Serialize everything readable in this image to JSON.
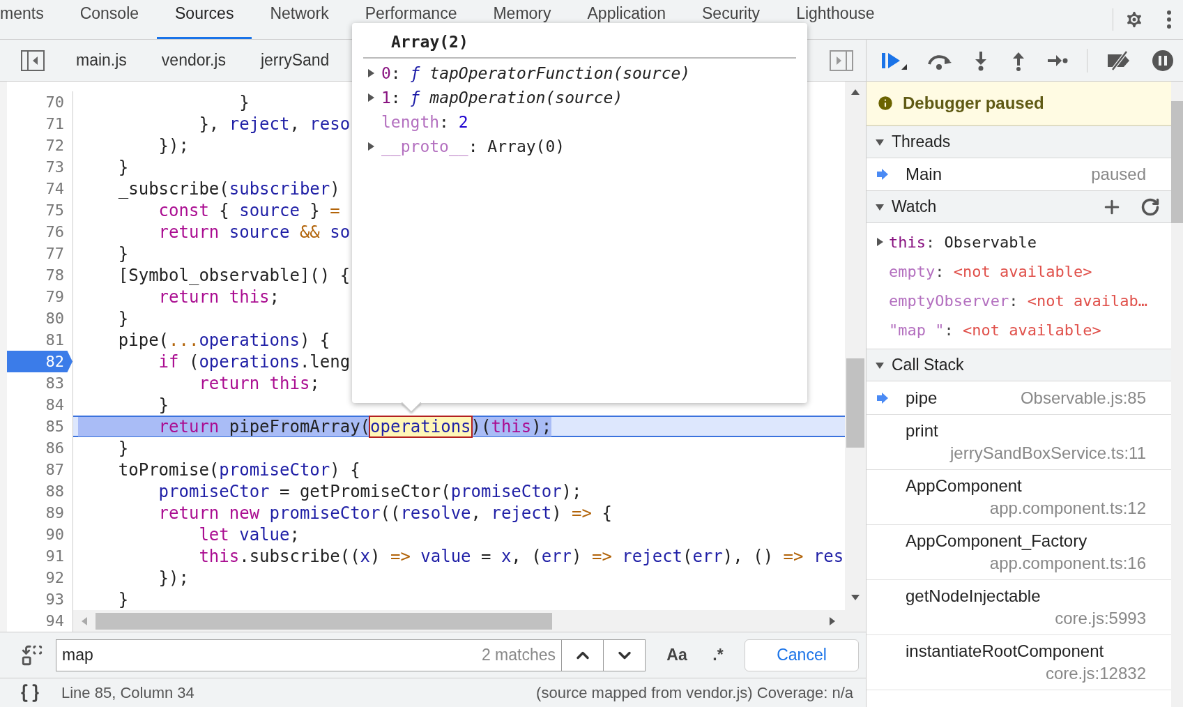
{
  "tabs": [
    {
      "label": "ments",
      "selected": false
    },
    {
      "label": "Console",
      "selected": false
    },
    {
      "label": "Sources",
      "selected": true
    },
    {
      "label": "Network",
      "selected": false
    },
    {
      "label": "Performance",
      "selected": false
    },
    {
      "label": "Memory",
      "selected": false
    },
    {
      "label": "Application",
      "selected": false
    },
    {
      "label": "Security",
      "selected": false
    },
    {
      "label": "Lighthouse",
      "selected": false
    }
  ],
  "file_tabs": [
    "main.js",
    "vendor.js",
    "jerrySand"
  ],
  "code": {
    "lines": [
      {
        "number": "70",
        "breakpoint": false,
        "current": false,
        "tokens": [
          {
            "text": "                }",
            "kind": "plain"
          }
        ]
      },
      {
        "number": "71",
        "breakpoint": false,
        "current": false,
        "tokens": [
          {
            "text": "            }, ",
            "kind": "plain"
          },
          {
            "text": "reject",
            "kind": "name"
          },
          {
            "text": ", ",
            "kind": "plain"
          },
          {
            "text": "reso",
            "kind": "name"
          }
        ]
      },
      {
        "number": "72",
        "breakpoint": false,
        "current": false,
        "tokens": [
          {
            "text": "        });",
            "kind": "plain"
          }
        ]
      },
      {
        "number": "73",
        "breakpoint": false,
        "current": false,
        "tokens": [
          {
            "text": "    }",
            "kind": "plain"
          }
        ]
      },
      {
        "number": "74",
        "breakpoint": false,
        "current": false,
        "tokens": [
          {
            "text": "    _subscribe(",
            "kind": "plain"
          },
          {
            "text": "subscriber",
            "kind": "name"
          },
          {
            "text": ")",
            "kind": "plain"
          }
        ]
      },
      {
        "number": "75",
        "breakpoint": false,
        "current": false,
        "tokens": [
          {
            "text": "        const",
            "kind": "keyword"
          },
          {
            "text": " { ",
            "kind": "plain"
          },
          {
            "text": "source",
            "kind": "name"
          },
          {
            "text": " } ",
            "kind": "plain"
          },
          {
            "text": "=",
            "kind": "operator"
          }
        ]
      },
      {
        "number": "76",
        "breakpoint": false,
        "current": false,
        "tokens": [
          {
            "text": "        return",
            "kind": "keyword"
          },
          {
            "text": " source",
            "kind": "name"
          },
          {
            "text": " &&",
            "kind": "operator"
          },
          {
            "text": " so",
            "kind": "name"
          }
        ]
      },
      {
        "number": "77",
        "breakpoint": false,
        "current": false,
        "tokens": [
          {
            "text": "    }",
            "kind": "plain"
          }
        ]
      },
      {
        "number": "78",
        "breakpoint": false,
        "current": false,
        "tokens": [
          {
            "text": "    [Symbol_observable]() {",
            "kind": "plain"
          }
        ]
      },
      {
        "number": "79",
        "breakpoint": false,
        "current": false,
        "tokens": [
          {
            "text": "        return",
            "kind": "keyword"
          },
          {
            "text": " this",
            "kind": "keyword"
          },
          {
            "text": ";",
            "kind": "plain"
          }
        ]
      },
      {
        "number": "80",
        "breakpoint": false,
        "current": false,
        "tokens": [
          {
            "text": "    }",
            "kind": "plain"
          }
        ]
      },
      {
        "number": "81",
        "breakpoint": false,
        "current": false,
        "tokens": [
          {
            "text": "    pipe(",
            "kind": "plain"
          },
          {
            "text": "...",
            "kind": "operator"
          },
          {
            "text": "operations",
            "kind": "name"
          },
          {
            "text": ") {",
            "kind": "plain"
          }
        ]
      },
      {
        "number": "82",
        "breakpoint": true,
        "current": false,
        "tokens": [
          {
            "text": "        if",
            "kind": "keyword"
          },
          {
            "text": " (",
            "kind": "plain"
          },
          {
            "text": "operations",
            "kind": "name"
          },
          {
            "text": ".leng",
            "kind": "plain"
          }
        ]
      },
      {
        "number": "83",
        "breakpoint": false,
        "current": false,
        "tokens": [
          {
            "text": "            return",
            "kind": "keyword"
          },
          {
            "text": " this",
            "kind": "keyword"
          },
          {
            "text": ";",
            "kind": "plain"
          }
        ]
      },
      {
        "number": "84",
        "breakpoint": false,
        "current": false,
        "tokens": [
          {
            "text": "        }",
            "kind": "plain"
          }
        ]
      },
      {
        "number": "85",
        "breakpoint": false,
        "current": true,
        "tokens": [
          {
            "text": "        return",
            "kind": "keyword"
          },
          {
            "text": " pipeFromArray(",
            "kind": "plain"
          },
          {
            "text": "operations",
            "kind": "match"
          },
          {
            "text": ")(",
            "kind": "plain"
          },
          {
            "text": "this",
            "kind": "keyword"
          },
          {
            "text": ");",
            "kind": "plain"
          }
        ]
      },
      {
        "number": "86",
        "breakpoint": false,
        "current": false,
        "tokens": [
          {
            "text": "    }",
            "kind": "plain"
          }
        ]
      },
      {
        "number": "87",
        "breakpoint": false,
        "current": false,
        "tokens": [
          {
            "text": "    toPromise(",
            "kind": "plain"
          },
          {
            "text": "promiseCtor",
            "kind": "name"
          },
          {
            "text": ") {",
            "kind": "plain"
          }
        ]
      },
      {
        "number": "88",
        "breakpoint": false,
        "current": false,
        "tokens": [
          {
            "text": "        promiseCtor",
            "kind": "name"
          },
          {
            "text": " = getPromiseCtor(",
            "kind": "plain"
          },
          {
            "text": "promiseCtor",
            "kind": "name"
          },
          {
            "text": ");",
            "kind": "plain"
          }
        ]
      },
      {
        "number": "89",
        "breakpoint": false,
        "current": false,
        "tokens": [
          {
            "text": "        return",
            "kind": "keyword"
          },
          {
            "text": " new",
            "kind": "keyword"
          },
          {
            "text": " promiseCtor",
            "kind": "name"
          },
          {
            "text": "((",
            "kind": "plain"
          },
          {
            "text": "resolve",
            "kind": "name"
          },
          {
            "text": ", ",
            "kind": "plain"
          },
          {
            "text": "reject",
            "kind": "name"
          },
          {
            "text": ") ",
            "kind": "plain"
          },
          {
            "text": "=>",
            "kind": "operator"
          },
          {
            "text": " {",
            "kind": "plain"
          }
        ]
      },
      {
        "number": "90",
        "breakpoint": false,
        "current": false,
        "tokens": [
          {
            "text": "            let",
            "kind": "keyword"
          },
          {
            "text": " value",
            "kind": "name"
          },
          {
            "text": ";",
            "kind": "plain"
          }
        ]
      },
      {
        "number": "91",
        "breakpoint": false,
        "current": false,
        "tokens": [
          {
            "text": "            this",
            "kind": "keyword"
          },
          {
            "text": ".subscribe((",
            "kind": "plain"
          },
          {
            "text": "x",
            "kind": "name"
          },
          {
            "text": ") ",
            "kind": "plain"
          },
          {
            "text": "=>",
            "kind": "operator"
          },
          {
            "text": " value",
            "kind": "name"
          },
          {
            "text": " = ",
            "kind": "plain"
          },
          {
            "text": "x",
            "kind": "name"
          },
          {
            "text": ", (",
            "kind": "plain"
          },
          {
            "text": "err",
            "kind": "name"
          },
          {
            "text": ") ",
            "kind": "plain"
          },
          {
            "text": "=>",
            "kind": "operator"
          },
          {
            "text": " reject",
            "kind": "name"
          },
          {
            "text": "(",
            "kind": "plain"
          },
          {
            "text": "err",
            "kind": "name"
          },
          {
            "text": "), () ",
            "kind": "plain"
          },
          {
            "text": "=>",
            "kind": "operator"
          },
          {
            "text": " res",
            "kind": "name"
          }
        ]
      },
      {
        "number": "92",
        "breakpoint": false,
        "current": false,
        "tokens": [
          {
            "text": "        });",
            "kind": "plain"
          }
        ]
      },
      {
        "number": "93",
        "breakpoint": false,
        "current": false,
        "tokens": [
          {
            "text": "    }",
            "kind": "plain"
          }
        ]
      },
      {
        "number": "94",
        "breakpoint": false,
        "current": false
      }
    ]
  },
  "popover": {
    "title": "Array(2)",
    "entries": [
      {
        "key": "0",
        "separator": ":",
        "kind": "function",
        "enumerable": true,
        "expandable": true,
        "prefix": "ƒ",
        "value": "tapOperatorFunction(source)"
      },
      {
        "key": "1",
        "separator": ":",
        "kind": "function",
        "enumerable": true,
        "expandable": true,
        "prefix": "ƒ",
        "value": "mapOperation(source)"
      },
      {
        "key": "length",
        "separator": ":",
        "kind": "number",
        "enumerable": false,
        "expandable": false,
        "value": "2"
      },
      {
        "key": "__proto__",
        "separator": ":",
        "kind": "object",
        "enumerable": false,
        "expandable": true,
        "value": "Array(0)"
      }
    ]
  },
  "search": {
    "query": "map",
    "matches": "2 matches",
    "case_label": "Aa",
    "regex_label": ".*",
    "cancel": "Cancel"
  },
  "status_bar": {
    "position": "Line 85, Column 34",
    "source": "(source mapped from vendor.js) Coverage: n/a"
  },
  "sidebar": {
    "banner": "Debugger paused",
    "threads": {
      "title": "Threads",
      "expanded": true,
      "items": [
        {
          "name": "Main",
          "status": "paused",
          "selected": true
        }
      ]
    },
    "watch": {
      "title": "Watch",
      "expanded": true,
      "items": [
        {
          "kind": "object",
          "name": "this",
          "separator": ":",
          "value": "Observable",
          "expandable": true
        },
        {
          "kind": "unavailable",
          "name": "empty",
          "separator": ":",
          "value": "<not available>",
          "expandable": false
        },
        {
          "kind": "unavailable",
          "name": "emptyObserver",
          "separator": ":",
          "value": "<not availab…",
          "expandable": false
        },
        {
          "kind": "unavailable",
          "name": "\"map \"",
          "separator": ":",
          "value": "<not available>",
          "expandable": false
        }
      ]
    },
    "call_stack": {
      "title": "Call Stack",
      "expanded": true,
      "frames": [
        {
          "kind": "inline",
          "name": "pipe",
          "location": "Observable.js:85",
          "selected": true
        },
        {
          "kind": "wrapped",
          "name": "print",
          "location": "jerrySandBoxService.ts:11",
          "selected": false
        },
        {
          "kind": "wrapped",
          "name": "AppComponent",
          "location": "app.component.ts:12",
          "selected": false
        },
        {
          "kind": "wrapped",
          "name": "AppComponent_Factory",
          "location": "app.component.ts:16",
          "selected": false
        },
        {
          "kind": "wrapped",
          "name": "getNodeInjectable",
          "location": "core.js:5993",
          "selected": false
        },
        {
          "kind": "wrapped",
          "name": "instantiateRootComponent",
          "location": "core.js:12832",
          "selected": false
        }
      ]
    }
  }
}
